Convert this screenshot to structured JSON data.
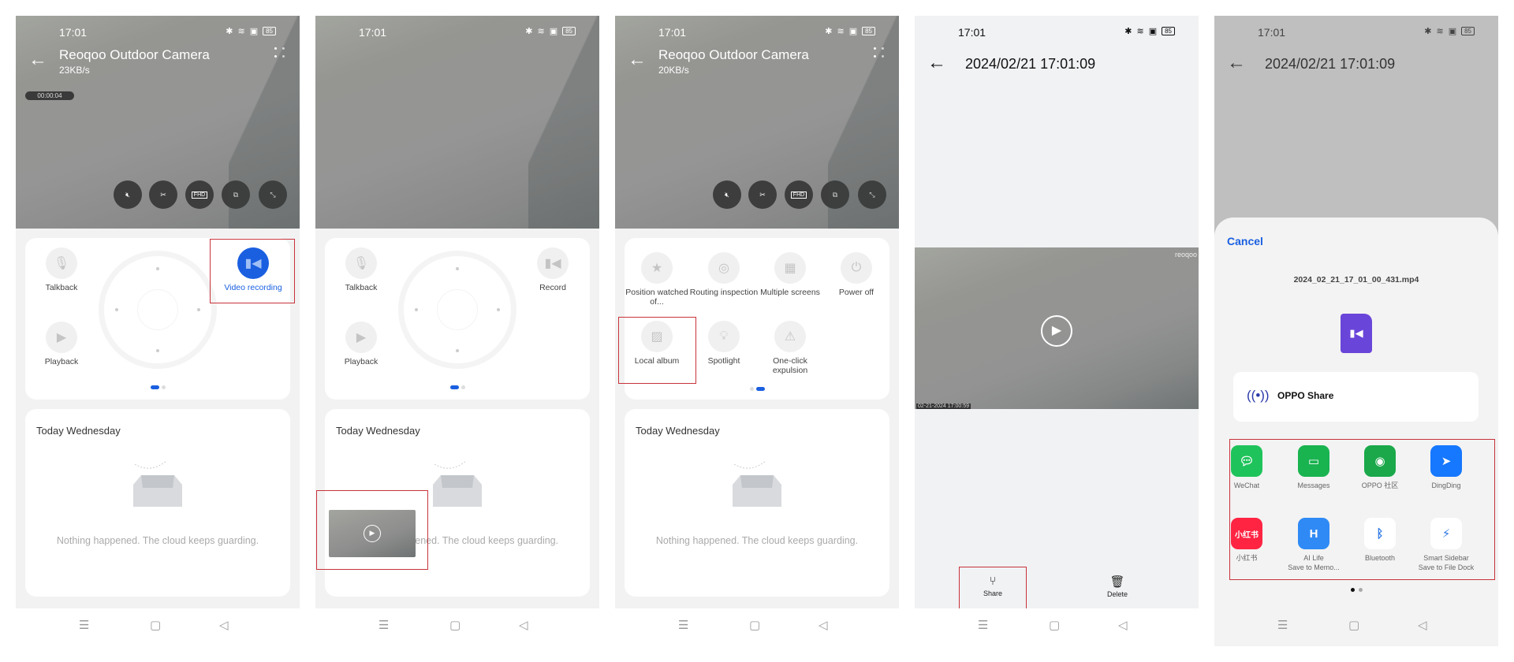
{
  "status": {
    "time": "17:01",
    "battery": "85"
  },
  "camera": {
    "title": "Reoqoo Outdoor Camera",
    "speed_1": "23KB/s",
    "speed_3": "20KB/s",
    "rec_timer": "00:00:04",
    "controls": [
      "mute-icon",
      "screenshot-icon",
      "FHD",
      "picture-in-picture-icon",
      "fullscreen-icon"
    ]
  },
  "tools_page1": {
    "talkback": "Talkback",
    "playback": "Playback",
    "video_recording": "Video recording",
    "record": "Record"
  },
  "tools_page2": [
    {
      "label": "Position watched of...",
      "icon": "star-icon"
    },
    {
      "label": "Routing inspection",
      "icon": "routing-icon"
    },
    {
      "label": "Multiple screens",
      "icon": "grid-icon"
    },
    {
      "label": "Power off",
      "icon": "power-icon"
    },
    {
      "label": "Local album",
      "icon": "image-icon"
    },
    {
      "label": "Spotlight",
      "icon": "bulb-icon"
    },
    {
      "label": "One-click expulsion",
      "icon": "alarm-icon"
    }
  ],
  "events": {
    "title": "Today Wednesday",
    "empty": "Nothing happened. The cloud keeps guarding."
  },
  "player": {
    "title": "2024/02/21 17:01:09",
    "osd_time": "02-21-2024 17:00:59",
    "watermark": "reoqoo",
    "share": "Share",
    "delete": "Delete"
  },
  "share_sheet": {
    "cancel": "Cancel",
    "filename": "2024_02_21_17_01_00_431.mp4",
    "oppo_share": "OPPO Share",
    "apps": [
      {
        "label": "WeChat",
        "sub": "",
        "color": "#1fc35b",
        "icon": "wechat-icon"
      },
      {
        "label": "Messages",
        "sub": "",
        "color": "#19b350",
        "icon": "messages-icon"
      },
      {
        "label": "OPPO 社区",
        "sub": "",
        "color": "#1aa84a",
        "icon": "oppo-community-icon"
      },
      {
        "label": "DingDing",
        "sub": "",
        "color": "#1677ff",
        "icon": "dingding-icon"
      },
      {
        "label": "小红书",
        "sub": "",
        "color": "#ff2442",
        "icon": "xiaohongshu-icon"
      },
      {
        "label": "AI Life",
        "sub": "Save to Memo...",
        "color": "#2f8af5",
        "icon": "ai-life-icon"
      },
      {
        "label": "Bluetooth",
        "sub": "",
        "color": "#ffffff",
        "icon": "bluetooth-icon"
      },
      {
        "label": "Smart Sidebar",
        "sub": "Save to File Dock",
        "color": "#ffffff",
        "icon": "file-dock-icon"
      }
    ]
  },
  "colors": {
    "accent": "#1a5fe0",
    "highlight": "#c8333a",
    "file_icon": "#6a45d9"
  }
}
